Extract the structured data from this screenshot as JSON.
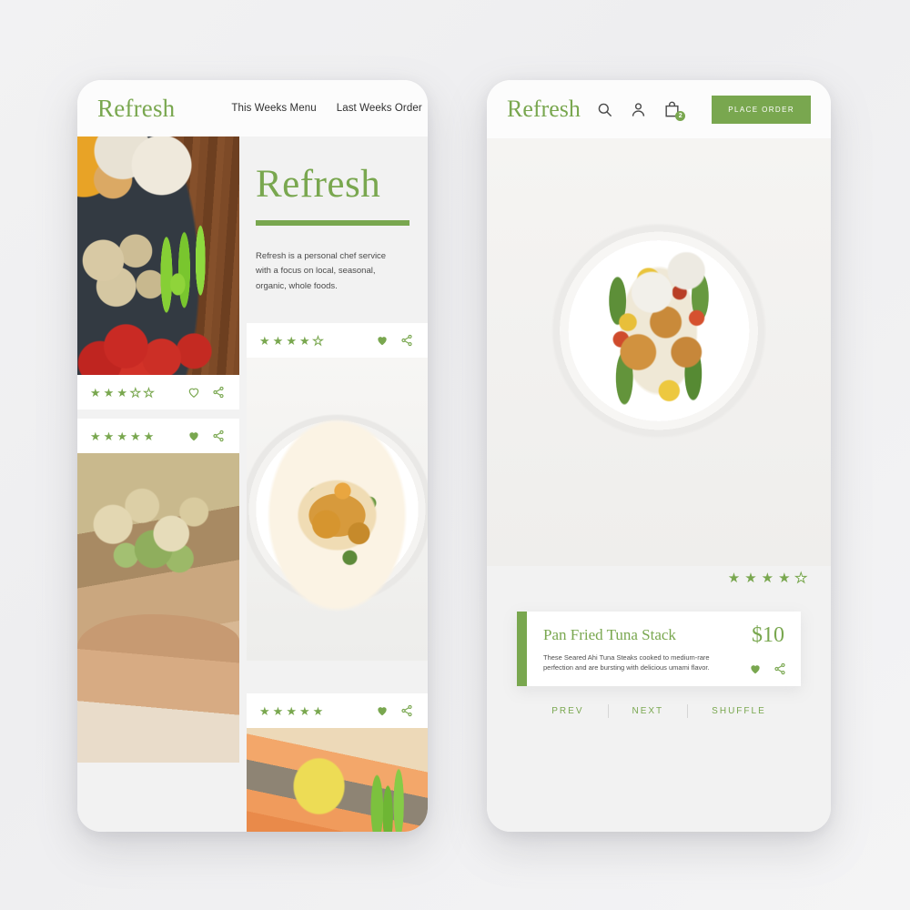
{
  "brand": {
    "name": "Refresh",
    "accent": "#79a74f"
  },
  "left_phone": {
    "logo": "Refresh",
    "nav": [
      {
        "label": "This Weeks Menu"
      },
      {
        "label": "Last Weeks Order"
      }
    ],
    "intro": {
      "title": "Refresh",
      "body": "Refresh is a personal chef service with a focus on local, seasonal, organic, whole foods."
    },
    "cards": [
      {
        "photo": "vegetable-platter-photo",
        "rating": 3,
        "rating_max": 5,
        "favorited": false,
        "heart_icon": "heart-outline-icon",
        "share_icon": "share-icon"
      },
      {
        "photo": "avocado-toast-photo",
        "rating": 5,
        "rating_max": 5,
        "favorited": true,
        "heart_icon": "heart-filled-icon",
        "share_icon": "share-icon"
      },
      {
        "photo": "plated-chicken-photo",
        "rating": 4,
        "rating_max": 5,
        "favorited": true,
        "heart_icon": "heart-filled-icon",
        "share_icon": "share-icon"
      },
      {
        "photo": "salmon-fillet-photo",
        "rating": 5,
        "rating_max": 5,
        "favorited": true,
        "heart_icon": "heart-filled-icon",
        "share_icon": "share-icon"
      }
    ]
  },
  "right_phone": {
    "logo": "Refresh",
    "header_icons": [
      {
        "name": "search-icon"
      },
      {
        "name": "user-account-icon"
      },
      {
        "name": "shopping-bag-icon",
        "badge": "2"
      }
    ],
    "place_order_label": "PLACE ORDER",
    "hero": {
      "photo": "pan-fried-tuna-stack-photo"
    },
    "dish": {
      "rating": 4,
      "rating_max": 5,
      "title": "Pan Fried Tuna Stack",
      "price": "$10",
      "description": "These Seared Ahi Tuna Steaks cooked to medium-rare perfection and are bursting with delicious umami flavor.",
      "favorited": true,
      "heart_icon": "heart-filled-icon",
      "share_icon": "share-icon"
    },
    "pager": [
      {
        "label": "PREV"
      },
      {
        "label": "NEXT"
      },
      {
        "label": "SHUFFLE"
      }
    ],
    "social": [
      {
        "name": "twitter-icon"
      },
      {
        "name": "facebook-icon"
      },
      {
        "name": "instagram-icon"
      },
      {
        "name": "youtube-icon"
      }
    ]
  }
}
